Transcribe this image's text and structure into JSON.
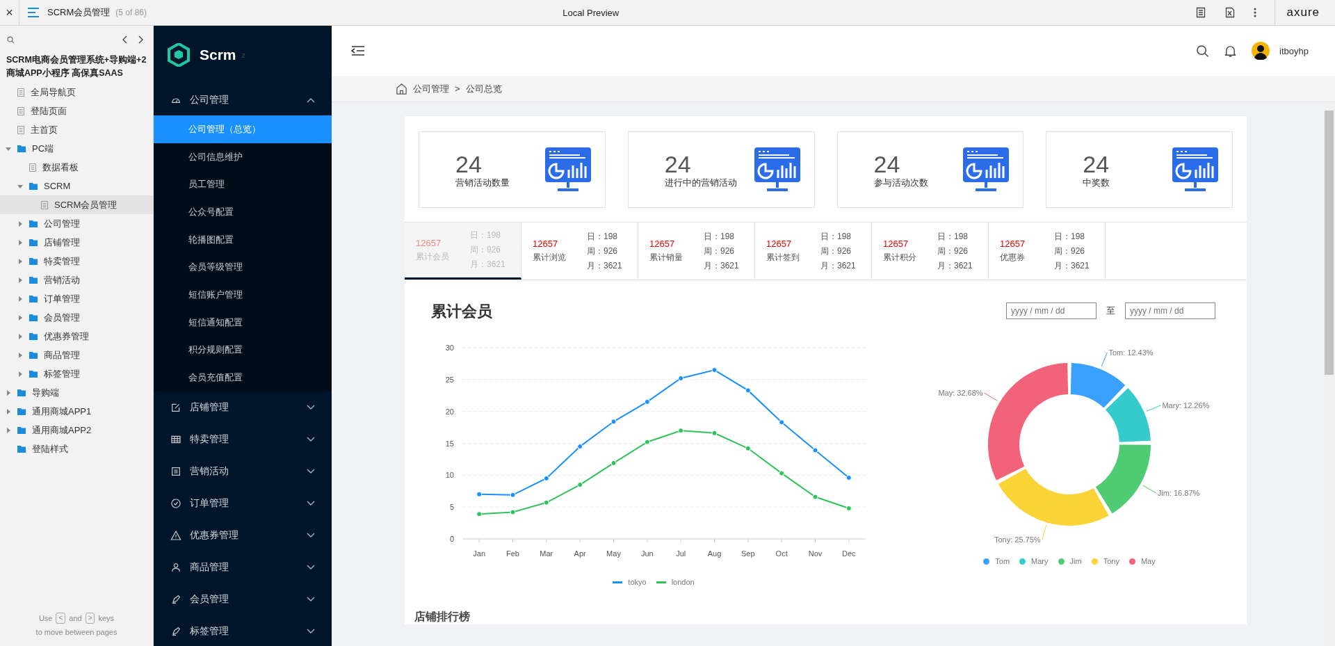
{
  "topbar": {
    "close": "×",
    "page_title": "SCRM会员管理",
    "page_count": "(5 of 86)",
    "center_title": "Local Preview",
    "brand": "axure"
  },
  "tree": {
    "title": "SCRM电商会员管理系统+导购端+2商城APP小程序 高保真SAAS",
    "items": [
      {
        "kind": "page",
        "label": "全局导航页",
        "selected": false
      },
      {
        "kind": "page",
        "label": "登陆页面",
        "selected": false
      },
      {
        "kind": "page",
        "label": "主首页",
        "selected": false
      },
      {
        "kind": "folder",
        "label": "PC端",
        "selected": false,
        "expanded": true,
        "children": [
          {
            "kind": "page",
            "label": "数据看板",
            "selected": false
          },
          {
            "kind": "folder",
            "label": "SCRM",
            "selected": false,
            "expanded": true,
            "children": [
              {
                "kind": "page",
                "label": "SCRM会员管理",
                "selected": true
              }
            ]
          },
          {
            "kind": "folder",
            "label": "公司管理",
            "selected": false,
            "expanded": false
          },
          {
            "kind": "folder",
            "label": "店铺管理",
            "selected": false,
            "expanded": false
          },
          {
            "kind": "folder",
            "label": "特卖管理",
            "selected": false,
            "expanded": false
          },
          {
            "kind": "folder",
            "label": "营销活动",
            "selected": false,
            "expanded": false
          },
          {
            "kind": "folder",
            "label": "订单管理",
            "selected": false,
            "expanded": false
          },
          {
            "kind": "folder",
            "label": "会员管理",
            "selected": false,
            "expanded": false
          },
          {
            "kind": "folder",
            "label": "优惠券管理",
            "selected": false,
            "expanded": false
          },
          {
            "kind": "folder",
            "label": "商品管理",
            "selected": false,
            "expanded": false
          },
          {
            "kind": "folder",
            "label": "标签管理",
            "selected": false,
            "expanded": false
          }
        ]
      },
      {
        "kind": "folder",
        "label": "导购端",
        "selected": false,
        "expanded": false
      },
      {
        "kind": "folder",
        "label": "通用商城APP1",
        "selected": false,
        "expanded": false
      },
      {
        "kind": "folder",
        "label": "通用商城APP2",
        "selected": false,
        "expanded": false
      },
      {
        "kind": "folder",
        "label": "登陆样式",
        "selected": false
      }
    ],
    "hint": {
      "use": "Use",
      "prev_key": "<",
      "and": "and",
      "next_key": ">",
      "keys": "keys",
      "line2": "to move between pages"
    }
  },
  "sidebar": {
    "logo": "Scrm",
    "logo_suffix": "z",
    "groups": [
      {
        "label": "公司管理",
        "expanded": true,
        "items": [
          {
            "label": "公司管理（总览）",
            "selected": true
          },
          {
            "label": "公司信息维护",
            "selected": false
          },
          {
            "label": "员工管理",
            "selected": false
          },
          {
            "label": "公众号配置",
            "selected": false
          },
          {
            "label": "轮播图配置",
            "selected": false
          },
          {
            "label": "会员等级管理",
            "selected": false
          },
          {
            "label": "短信账户管理",
            "selected": false
          },
          {
            "label": "短信通知配置",
            "selected": false
          },
          {
            "label": "积分规则配置",
            "selected": false
          },
          {
            "label": "会员充值配置",
            "selected": false
          }
        ]
      },
      {
        "label": "店铺管理",
        "expanded": false
      },
      {
        "label": "特卖管理",
        "expanded": false
      },
      {
        "label": "营销活动",
        "expanded": false
      },
      {
        "label": "订单管理",
        "expanded": false
      },
      {
        "label": "优惠券管理",
        "expanded": false
      },
      {
        "label": "商品管理",
        "expanded": false
      },
      {
        "label": "会员管理",
        "expanded": false
      },
      {
        "label": "标签管理",
        "expanded": false
      }
    ]
  },
  "header": {
    "username": "itboyhp"
  },
  "breadcrumb": [
    "公司管理",
    "公司总览"
  ],
  "breadcrumb_separator": ">",
  "stat_cards": [
    {
      "value": "24",
      "label": "营销活动数量"
    },
    {
      "value": "24",
      "label": "进行中的营销活动"
    },
    {
      "value": "24",
      "label": "参与活动次数"
    },
    {
      "value": "24",
      "label": "中奖数"
    }
  ],
  "metric_tabs": [
    {
      "value": "12657",
      "label": "累计会员",
      "day": "日：198",
      "week": "周：926",
      "month": "月：3621",
      "selected": true
    },
    {
      "value": "12657",
      "label": "累计浏览",
      "day": "日：198",
      "week": "周：926",
      "month": "月：3621",
      "selected": false
    },
    {
      "value": "12657",
      "label": "累计销量",
      "day": "日：198",
      "week": "周：926",
      "month": "月：3621",
      "selected": false
    },
    {
      "value": "12657",
      "label": "累计签到",
      "day": "日：198",
      "week": "周：926",
      "month": "月：3621",
      "selected": false
    },
    {
      "value": "12657",
      "label": "累计积分",
      "day": "日：198",
      "week": "周：926",
      "month": "月：3621",
      "selected": false
    },
    {
      "value": "12657",
      "label": "优惠券",
      "day": "日：198",
      "week": "周：926",
      "month": "月：3621",
      "selected": false
    }
  ],
  "chart_section": {
    "title": "累计会员",
    "date_from": {
      "placeholder": "yyyy / mm / dd"
    },
    "date_separator": "至",
    "date_to": {
      "placeholder": "yyyy / mm / dd"
    },
    "line_chart": {
      "chart_data": {
        "type": "line",
        "categories": [
          "Jan",
          "Feb",
          "Mar",
          "Apr",
          "May",
          "Jun",
          "Jul",
          "Aug",
          "Sep",
          "Oct",
          "Nov",
          "Dec"
        ],
        "ylim": [
          0,
          30
        ],
        "yticks": [
          0,
          5,
          10,
          15,
          20,
          25,
          30
        ],
        "grid": true,
        "series": [
          {
            "name": "tokyo",
            "color": "#1890ff",
            "marker": true,
            "values": [
              7.0,
              6.9,
              9.5,
              14.5,
              18.4,
              21.5,
              25.2,
              26.5,
              23.3,
              18.3,
              13.9,
              9.6
            ]
          },
          {
            "name": "london",
            "color": "#2fc25b",
            "marker": true,
            "values": [
              3.9,
              4.2,
              5.7,
              8.5,
              11.9,
              15.2,
              17.0,
              16.6,
              14.2,
              10.3,
              6.6,
              4.8
            ]
          }
        ]
      }
    },
    "donut_chart": {
      "chart_data": {
        "type": "donut",
        "categories": [
          "Tom",
          "Mary",
          "Jim",
          "Tony",
          "May"
        ],
        "values": [
          12.43,
          12.26,
          16.87,
          25.75,
          32.68
        ],
        "colors": [
          "#3aa1ff",
          "#36cbcb",
          "#4ecb73",
          "#fad337",
          "#f2637b"
        ],
        "value_labels": [
          "Tom: 12.43%",
          "Mary: 12.26%",
          "Jim: 16.87%",
          "Tony: 25.75%",
          "May: 32.68%"
        ]
      }
    }
  },
  "ranking_title": "店铺排行榜"
}
